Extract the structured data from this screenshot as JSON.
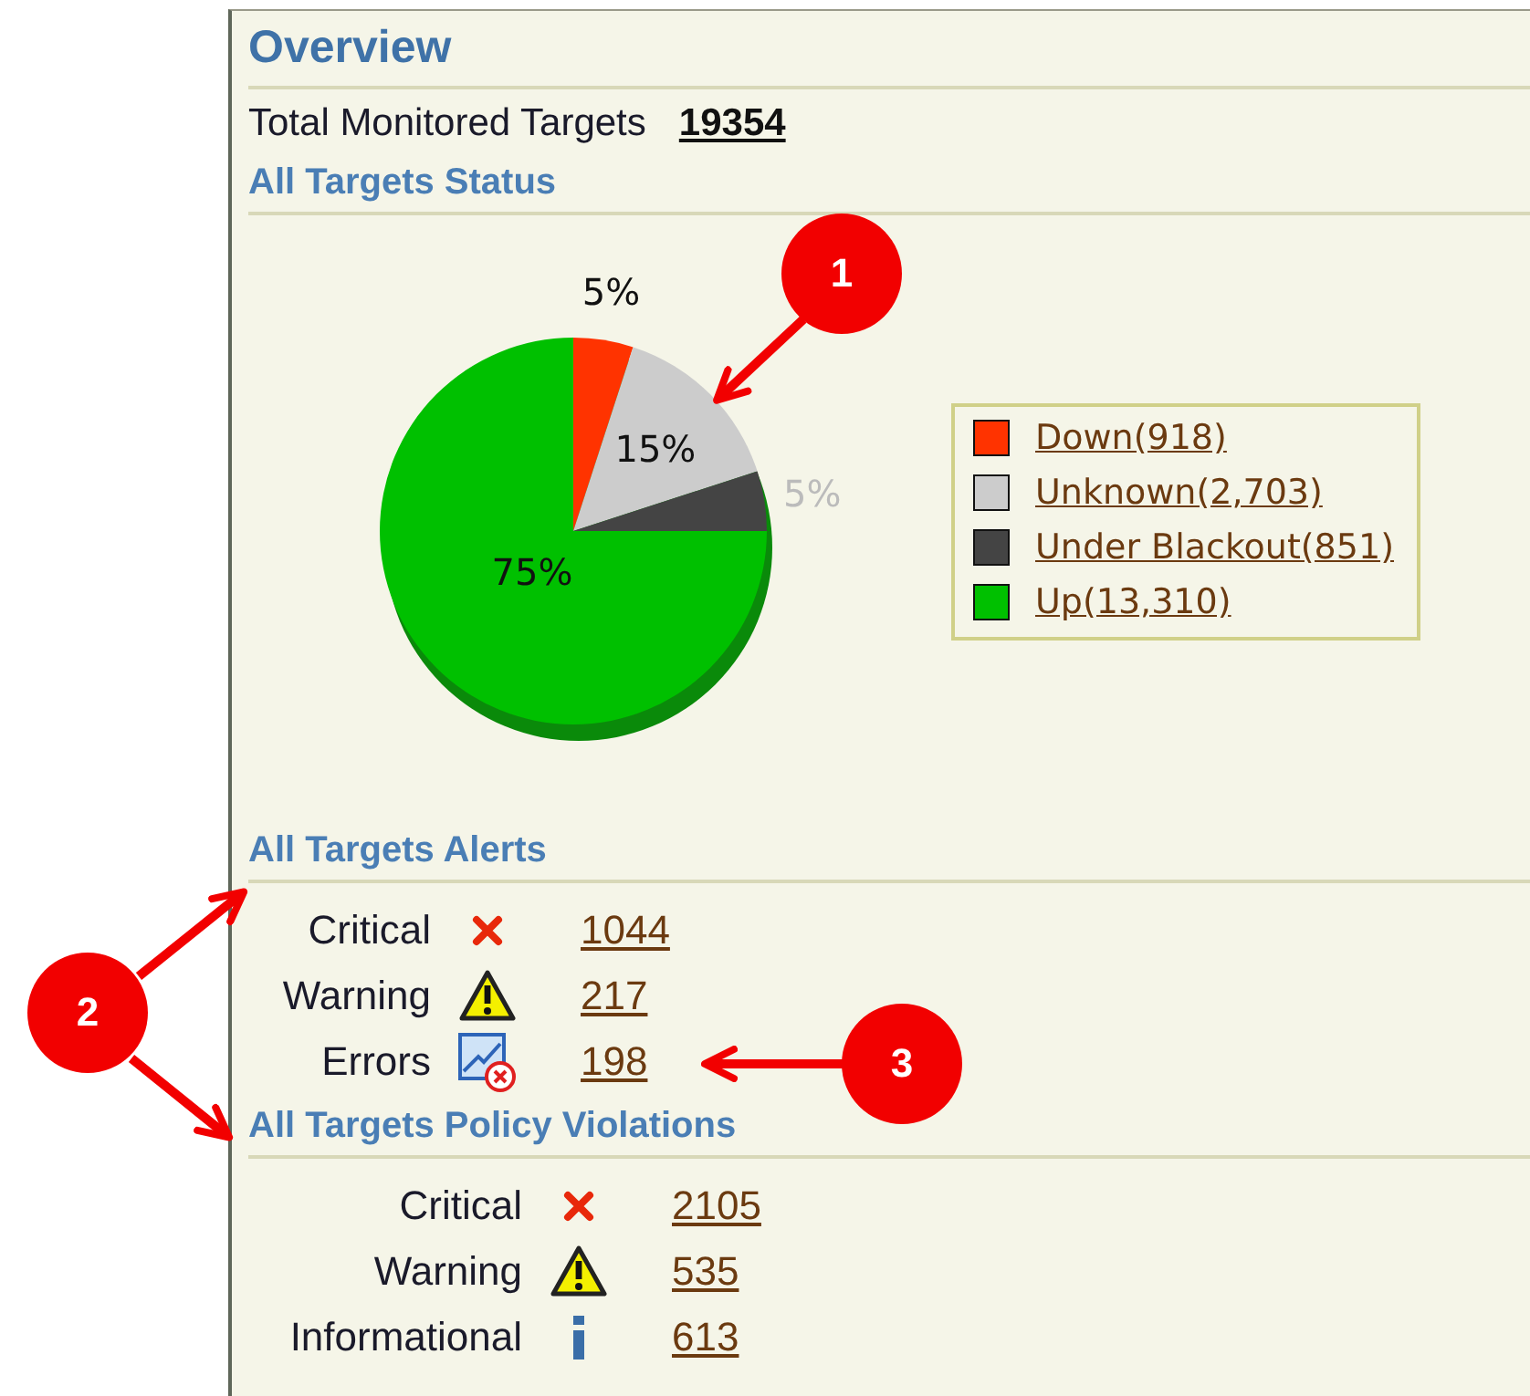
{
  "title": "Overview",
  "total": {
    "label": "Total Monitored Targets",
    "value": "19354"
  },
  "status": {
    "heading": "All Targets Status",
    "chart_data": {
      "type": "pie",
      "categories": [
        "Down(918)",
        "Unknown(2,703)",
        "Under Blackout(851)",
        "Up(13,310)"
      ],
      "values": [
        5,
        15,
        5,
        75
      ],
      "colors": [
        "#ff3300",
        "#cccccc",
        "#444444",
        "#00c000"
      ],
      "value_labels": [
        "5%",
        "15%",
        "5%",
        "75%"
      ]
    }
  },
  "alerts": {
    "heading": "All Targets Alerts",
    "rows": [
      {
        "kind": "critical",
        "label": "Critical",
        "value": "1044"
      },
      {
        "kind": "warning",
        "label": "Warning",
        "value": "217"
      },
      {
        "kind": "errors",
        "label": "Errors",
        "value": "198"
      }
    ]
  },
  "violations": {
    "heading": "All Targets Policy Violations",
    "rows": [
      {
        "kind": "critical",
        "label": "Critical",
        "value": "2105"
      },
      {
        "kind": "warning",
        "label": "Warning",
        "value": "535"
      },
      {
        "kind": "info",
        "label": "Informational",
        "value": "613"
      }
    ]
  },
  "callouts": [
    "1",
    "2",
    "3"
  ]
}
